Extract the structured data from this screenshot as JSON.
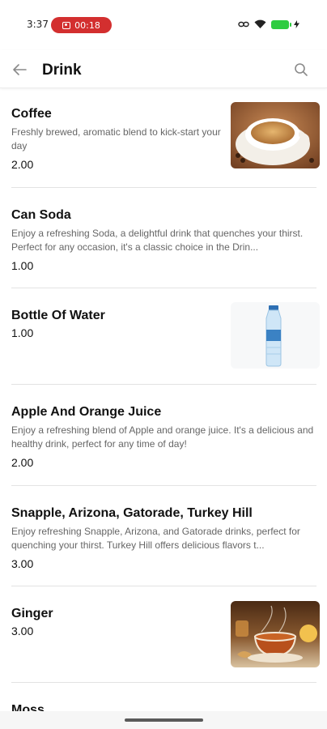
{
  "status_bar": {
    "time": "3:37",
    "recording_timer": "00:18"
  },
  "header": {
    "title": "Drink",
    "back_icon": "arrow-left-icon",
    "search_icon": "search-icon"
  },
  "items": [
    {
      "name": "Coffee",
      "description": "Freshly brewed, aromatic blend to kick-start your day",
      "price": "2.00",
      "image": "coffee-cup"
    },
    {
      "name": "Can Soda",
      "description": "Enjoy a refreshing Soda, a delightful drink that quenches your thirst. Perfect for any occasion, it's a classic choice in the Drin...",
      "price": "1.00",
      "image": ""
    },
    {
      "name": "Bottle Of Water",
      "description": "",
      "price": "1.00",
      "image": "water-bottle"
    },
    {
      "name": "Apple And Orange Juice",
      "description": "Enjoy a refreshing blend of Apple and orange juice. It's a delicious and healthy drink, perfect for any time of day!",
      "price": "2.00",
      "image": ""
    },
    {
      "name": "Snapple, Arizona, Gatorade, Turkey Hill",
      "description": "Enjoy refreshing Snapple, Arizona, and Gatorade drinks, perfect for quenching your thirst. Turkey Hill offers delicious flavors t...",
      "price": "3.00",
      "image": ""
    },
    {
      "name": "Ginger",
      "description": "",
      "price": "3.00",
      "image": "ginger-tea"
    },
    {
      "name": "Moss",
      "description": "",
      "price": "",
      "image": ""
    }
  ],
  "colors": {
    "recording_pill": "#d32f2f",
    "battery": "#2ecc40",
    "divider": "#e3e3e3"
  }
}
